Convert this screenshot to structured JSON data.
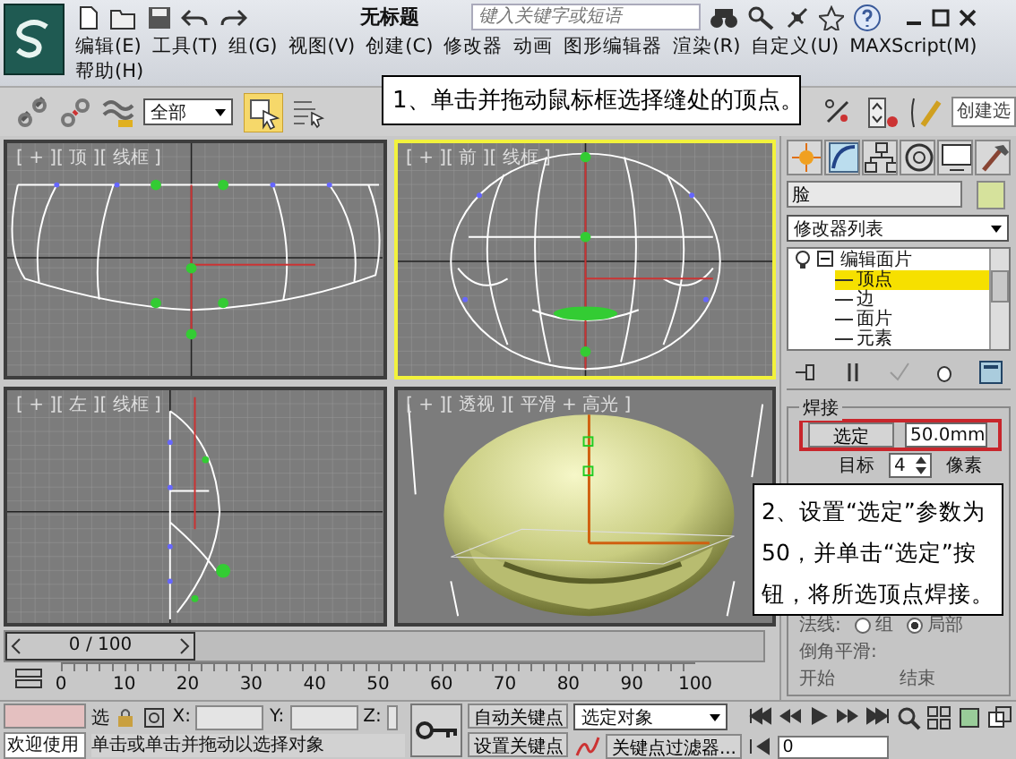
{
  "title_bar": {
    "title": "无标题",
    "search": {
      "placeholder": "键入关键字或短语"
    }
  },
  "menu": [
    "编辑(E)",
    "工具(T)",
    "组(G)",
    "视图(V)",
    "创建(C)",
    "修改器",
    "动画",
    "图形编辑器",
    "渲染(R)",
    "自定义(U)",
    "MAXScript(M)",
    "帮助(H)"
  ],
  "toolbar": {
    "selection_filter": "全部",
    "named_selection": "创建选"
  },
  "callouts": [
    {
      "text": "1、单击并拖动鼠标框选择缝处的顶点。"
    },
    {
      "text": "2、设置“选定”参数为50，并单击“选定”按钮，将所选顶点焊接。"
    }
  ],
  "viewports": [
    {
      "label": "[ + ][ 顶 ][ 线框 ]",
      "kind": "top",
      "selected": false
    },
    {
      "label": "[ + ][ 前 ][ 线框 ]",
      "kind": "front",
      "selected": true
    },
    {
      "label": "[ + ][ 左 ][ 线框 ]",
      "kind": "left",
      "selected": false
    },
    {
      "label": "[ + ][ 透视 ][ 平滑 + 高光 ]",
      "kind": "perspective",
      "selected": false
    }
  ],
  "command_panel": {
    "object_name": "脸",
    "modifier_list": "修改器列表",
    "stack": [
      {
        "label": "编辑面片",
        "expanded": true,
        "children": [
          {
            "label": "顶点",
            "selected": true
          },
          {
            "label": "边",
            "selected": false
          },
          {
            "label": "面片",
            "selected": false
          },
          {
            "label": "元素",
            "selected": false
          }
        ]
      }
    ],
    "rollout": {
      "title": "焊接",
      "weld_button": "选定",
      "weld_value": "50.0mm",
      "target_label": "目标",
      "target_value": "4",
      "target_unit": "像素",
      "normals_label": "法线:",
      "normals_options": [
        {
          "label": "组",
          "selected": false
        },
        {
          "label": "局部",
          "selected": true
        }
      ],
      "bevel_label": "倒角平滑:",
      "bevel_start": "开始",
      "bevel_end": "结束"
    }
  },
  "timeline": {
    "slider": "0 / 100",
    "level": 0,
    "ticks": [
      "0",
      "10",
      "20",
      "30",
      "40",
      "50",
      "60",
      "70",
      "80",
      "90",
      "100"
    ]
  },
  "status_bar": {
    "welcome": "欢迎使用",
    "select_label": "选",
    "x_label": "X:",
    "y_label": "Y:",
    "z_label": "Z:",
    "auto_key": "自动关键点",
    "set_key": "设置关键点",
    "key_mode": "选定对象",
    "key_filters": "关键点过滤器...",
    "frame": "0",
    "prompt": "单击或单击并拖动以选择对象"
  }
}
